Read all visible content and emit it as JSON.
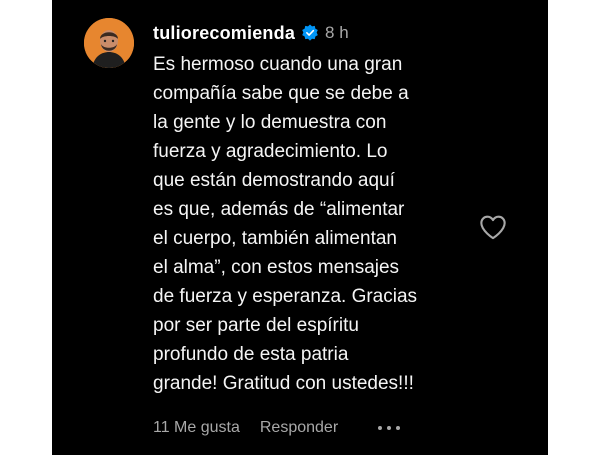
{
  "comment": {
    "username": "tuliorecomienda",
    "time": "8 h",
    "lines": [
      "Es hermoso cuando una gran",
      "compañía sabe que se debe a",
      "la gente y lo demuestra con",
      "fuerza y agradecimiento. Lo",
      "que están demostrando aquí",
      "es que, además de “alimentar",
      "el cuerpo, también alimentan",
      "el alma”, con estos mensajes",
      "de fuerza y esperanza. Gracias",
      "por ser parte del espíritu",
      "profundo de esta patria",
      "grande! Gratitud con ustedes!!!"
    ],
    "likes_label": "11 Me gusta",
    "reply_label": "Responder"
  },
  "icons": {
    "verified": "verified-badge-icon",
    "like": "heart-icon",
    "more": "more-options-icon"
  },
  "colors": {
    "background": "#000000",
    "text": "#f5f5f5",
    "secondary": "#a8a8a8",
    "verified": "#0095f6"
  }
}
